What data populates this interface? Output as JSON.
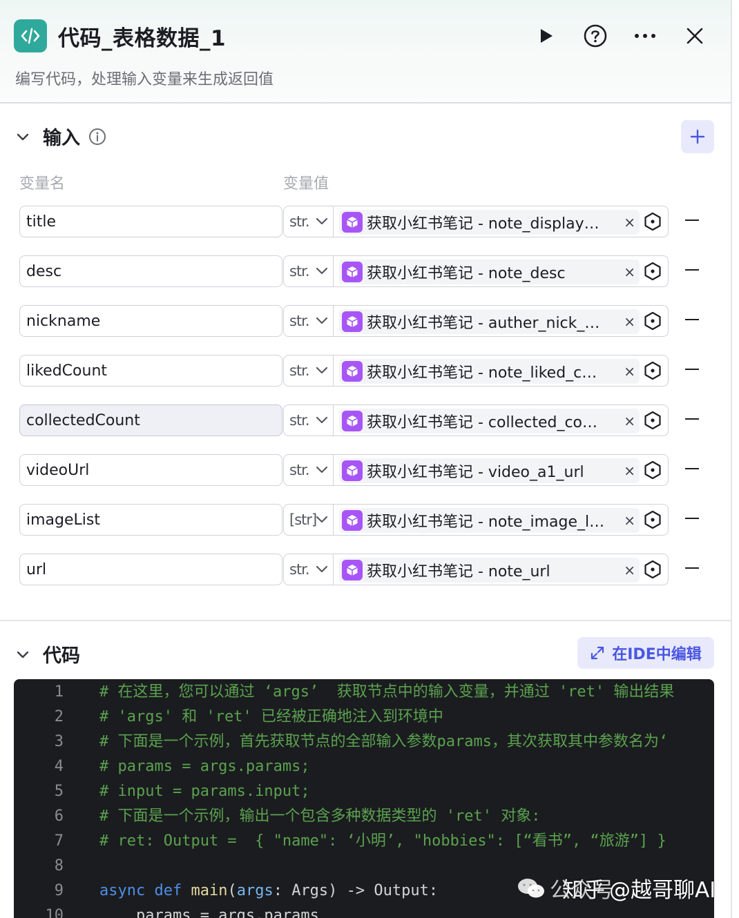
{
  "header": {
    "title": "代码_表格数据_1",
    "description": "编写代码，处理输入变量来生成返回值"
  },
  "input_section": {
    "title": "输入",
    "col_name": "变量名",
    "col_value": "变量值",
    "rows": [
      {
        "name": "title",
        "type": "str.",
        "ref": "获取小红书笔记 - note_display…"
      },
      {
        "name": "desc",
        "type": "str.",
        "ref": "获取小红书笔记 - note_desc"
      },
      {
        "name": "nickname",
        "type": "str.",
        "ref": "获取小红书笔记 - auther_nick_…"
      },
      {
        "name": "likedCount",
        "type": "str.",
        "ref": "获取小红书笔记 - note_liked_c…"
      },
      {
        "name": "collectedCount",
        "type": "str.",
        "ref": "获取小红书笔记 - collected_co…"
      },
      {
        "name": "videoUrl",
        "type": "str.",
        "ref": "获取小红书笔记 - video_a1_url"
      },
      {
        "name": "imageList",
        "type": "[str]",
        "ref": "获取小红书笔记 - note_image_l…"
      },
      {
        "name": "url",
        "type": "str.",
        "ref": "获取小红书笔记 - note_url"
      }
    ]
  },
  "code_section": {
    "title": "代码",
    "ide_button": "在IDE中编辑",
    "lines": [
      {
        "num": "1",
        "text": "# 在这里，您可以通过 ‘args’  获取节点中的输入变量，并通过 'ret' 输出结果"
      },
      {
        "num": "2",
        "text": "# 'args' 和 'ret' 已经被正确地注入到环境中"
      },
      {
        "num": "3",
        "text": "# 下面是一个示例，首先获取节点的全部输入参数params，其次获取其中参数名为‘"
      },
      {
        "num": "4",
        "text": "# params = args.params;"
      },
      {
        "num": "5",
        "text": "# input = params.input;"
      },
      {
        "num": "6",
        "text": "# 下面是一个示例，输出一个包含多种数据类型的 'ret' 对象:"
      },
      {
        "num": "7",
        "text": "# ret: Output =  { \"name\": ‘小明’, \"hobbies\": [“看书”, “旅游”] }"
      },
      {
        "num": "8",
        "text": ""
      },
      {
        "num": "9",
        "kw1": "async",
        "kw2": "def",
        "fn": "main",
        "param": "args",
        "rest1": ": Args) -> Output:"
      },
      {
        "num": "10",
        "text": "    params = args.params"
      }
    ]
  },
  "watermark": {
    "brand": "知乎",
    "handle": "@越哥聊AI",
    "dim_text": "公众号"
  },
  "colors": {
    "accent": "#4a56e2",
    "node_icon": "#2fa99b",
    "tag_icon": "#a855f7"
  }
}
